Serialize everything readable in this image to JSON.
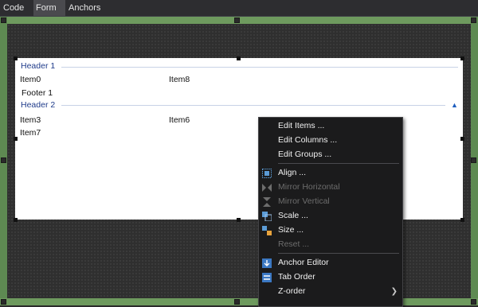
{
  "tabs": [
    "Code",
    "Form",
    "Anchors"
  ],
  "active_tab": "Form",
  "listview": {
    "groups": [
      {
        "header": "Header 1",
        "items": [
          "Item0",
          "Item8"
        ],
        "footer": "Footer 1"
      },
      {
        "header": "Header 2",
        "items": [
          "Item3",
          "Item6",
          "Item7"
        ]
      }
    ]
  },
  "context_menu": {
    "items": [
      {
        "label": "Edit Items ...",
        "enabled": true,
        "icon": null
      },
      {
        "label": "Edit Columns ...",
        "enabled": true,
        "icon": null
      },
      {
        "label": "Edit Groups ...",
        "enabled": true,
        "icon": null
      },
      {
        "label": "Align ...",
        "enabled": true,
        "icon": "align-icon"
      },
      {
        "label": "Mirror Horizontal",
        "enabled": false,
        "icon": "mirror-horizontal-icon"
      },
      {
        "label": "Mirror Vertical",
        "enabled": false,
        "icon": "mirror-vertical-icon"
      },
      {
        "label": "Scale ...",
        "enabled": true,
        "icon": "scale-icon"
      },
      {
        "label": "Size ...",
        "enabled": true,
        "icon": "size-icon"
      },
      {
        "label": "Reset ...",
        "enabled": false,
        "icon": null
      },
      {
        "label": "Anchor Editor",
        "enabled": true,
        "icon": "anchor-editor-icon"
      },
      {
        "label": "Tab Order",
        "enabled": true,
        "icon": "tab-order-icon"
      },
      {
        "label": "Z-order",
        "enabled": true,
        "icon": null,
        "submenu": true
      }
    ]
  },
  "colors": {
    "frame_green": "#6e9a5e",
    "menu_bg": "#1b1b1c",
    "group_header": "#1f3b8a",
    "disabled_text": "#6d6d6d"
  }
}
